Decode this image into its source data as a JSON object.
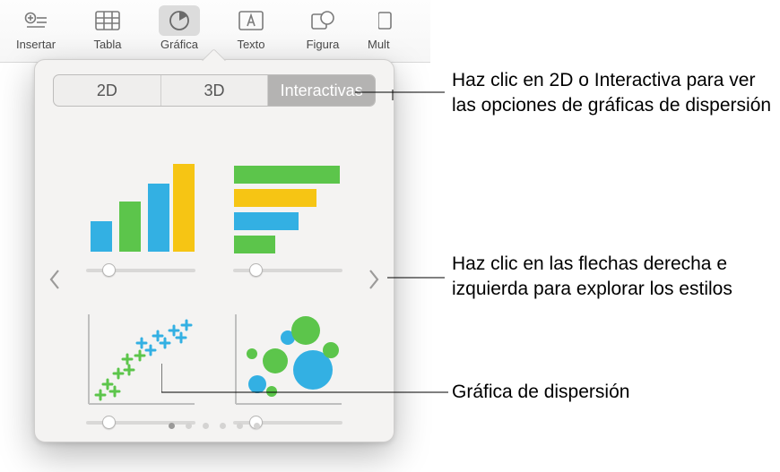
{
  "toolbar": {
    "items": [
      {
        "label": "Insertar"
      },
      {
        "label": "Tabla"
      },
      {
        "label": "Gráfica"
      },
      {
        "label": "Texto"
      },
      {
        "label": "Figura"
      },
      {
        "label": "Multimedia"
      }
    ]
  },
  "popover": {
    "tabs": [
      "2D",
      "3D",
      "Interactivas"
    ],
    "selected_tab_index": 2,
    "page_count": 6,
    "active_page_index": 0
  },
  "callouts": {
    "tabs": "Haz clic en 2D o Interactiva para ver las opciones de gráficas de dispersión",
    "arrows": "Haz clic en las flechas derecha e izquierda para explorar los estilos",
    "scatter": "Gráfica de dispersión"
  },
  "colors": {
    "blue": "#33b0e3",
    "green": "#5cc54b",
    "yellow": "#f6c514"
  }
}
